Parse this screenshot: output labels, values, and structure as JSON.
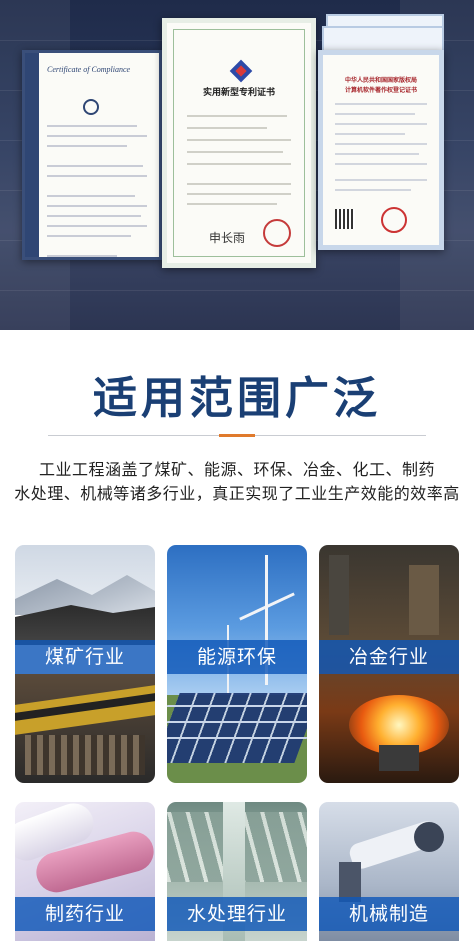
{
  "hero": {
    "cert_left": {
      "title": "Certificate of Compliance"
    },
    "cert_middle": {
      "title": "实用新型专利证书",
      "signature": "申长雨"
    },
    "cert_right": {
      "title_line1": "中华人民共和国国家版权局",
      "title_line2": "计算机软件著作权登记证书"
    }
  },
  "section": {
    "heading": "适用范围广泛",
    "description_line1": "工业工程涵盖了煤矿、能源、环保、冶金、化工、制药",
    "description_line2": "水处理、机械等诸多行业，真正实现了工业生产效能的效率高"
  },
  "industries": [
    {
      "label": "煤矿行业"
    },
    {
      "label": "能源环保"
    },
    {
      "label": "冶金行业"
    },
    {
      "label": "制药行业"
    },
    {
      "label": "水处理行业"
    },
    {
      "label": "机械制造"
    }
  ],
  "colors": {
    "heading": "#1a3f74",
    "accent": "#e07a2c",
    "label_bg": "#1058b8"
  }
}
